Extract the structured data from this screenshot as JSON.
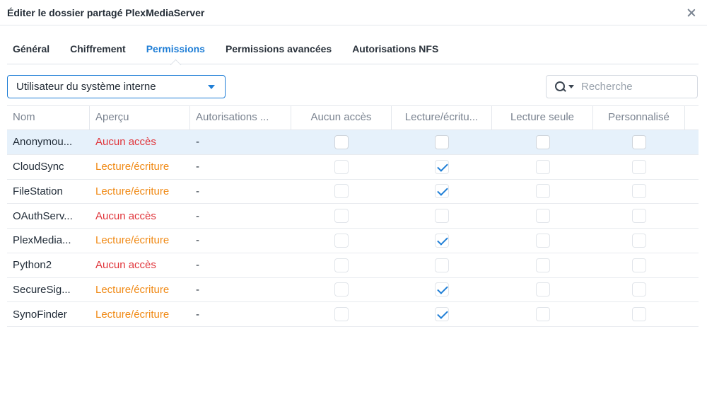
{
  "window": {
    "title": "Éditer le dossier partagé PlexMediaServer",
    "close_icon": "close-icon"
  },
  "tabs": [
    {
      "label": "Général",
      "active": false
    },
    {
      "label": "Chiffrement",
      "active": false
    },
    {
      "label": "Permissions",
      "active": true
    },
    {
      "label": "Permissions avancées",
      "active": false
    },
    {
      "label": "Autorisations NFS",
      "active": false
    }
  ],
  "toolbar": {
    "user_type_selected": "Utilisateur du système interne",
    "search_placeholder": "Recherche",
    "search_icon": "search-icon"
  },
  "colors": {
    "accent": "#1f7ed6",
    "no_access": "#e0353b",
    "read_write": "#f08a16",
    "selected_row": "#e6f1fb"
  },
  "table": {
    "columns": [
      "Nom",
      "Aperçu",
      "Autorisations ...",
      "Aucun accès",
      "Lecture/écritu...",
      "Lecture seule",
      "Personnalisé"
    ],
    "rows": [
      {
        "name": "Anonymou...",
        "preview": "Aucun accès",
        "preview_type": "none",
        "inherited": "-",
        "no_access": false,
        "read_write": false,
        "read_only": false,
        "custom": false,
        "selected": true,
        "enabled": true
      },
      {
        "name": "CloudSync",
        "preview": "Lecture/écriture",
        "preview_type": "rw",
        "inherited": "-",
        "no_access": false,
        "read_write": true,
        "read_only": false,
        "custom": false,
        "selected": false,
        "enabled": false
      },
      {
        "name": "FileStation",
        "preview": "Lecture/écriture",
        "preview_type": "rw",
        "inherited": "-",
        "no_access": false,
        "read_write": true,
        "read_only": false,
        "custom": false,
        "selected": false,
        "enabled": false
      },
      {
        "name": "OAuthServ...",
        "preview": "Aucun accès",
        "preview_type": "none",
        "inherited": "-",
        "no_access": false,
        "read_write": false,
        "read_only": false,
        "custom": false,
        "selected": false,
        "enabled": false
      },
      {
        "name": "PlexMedia...",
        "preview": "Lecture/écriture",
        "preview_type": "rw",
        "inherited": "-",
        "no_access": false,
        "read_write": true,
        "read_only": false,
        "custom": false,
        "selected": false,
        "enabled": false
      },
      {
        "name": "Python2",
        "preview": "Aucun accès",
        "preview_type": "none",
        "inherited": "-",
        "no_access": false,
        "read_write": false,
        "read_only": false,
        "custom": false,
        "selected": false,
        "enabled": false
      },
      {
        "name": "SecureSig...",
        "preview": "Lecture/écriture",
        "preview_type": "rw",
        "inherited": "-",
        "no_access": false,
        "read_write": true,
        "read_only": false,
        "custom": false,
        "selected": false,
        "enabled": false
      },
      {
        "name": "SynoFinder",
        "preview": "Lecture/écriture",
        "preview_type": "rw",
        "inherited": "-",
        "no_access": false,
        "read_write": true,
        "read_only": false,
        "custom": false,
        "selected": false,
        "enabled": false
      }
    ]
  }
}
